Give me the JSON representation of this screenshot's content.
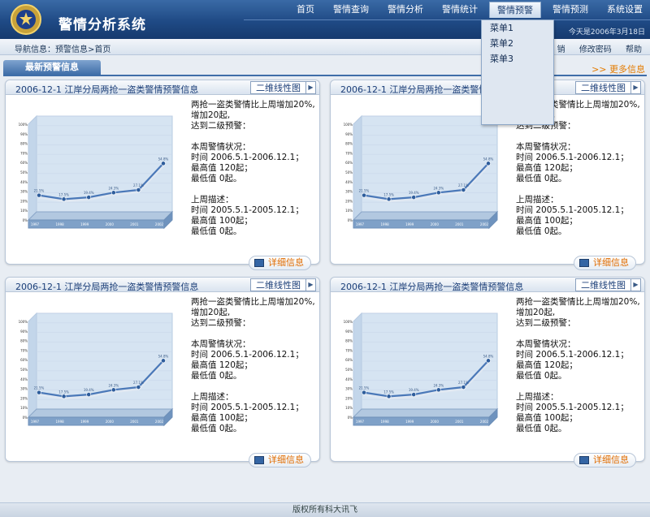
{
  "header": {
    "title": "警情分析系统",
    "user_info": "今天是2006年3月18日"
  },
  "nav": [
    "首页",
    "警情查询",
    "警情分析",
    "警情统计",
    "警情预警",
    "警情预测",
    "系统设置"
  ],
  "nav_active": 4,
  "dropdown": [
    "菜单1",
    "菜单2",
    "菜单3"
  ],
  "breadcrumb": "导航信息：预警信息>首页",
  "quick_links": [
    "销",
    "修改密码",
    "帮助"
  ],
  "section": {
    "tab": "最新预警信息",
    "more": ">> 更多信息"
  },
  "panels": [
    {
      "title": "2006-12-1 江岸分局两抢一盗类警情预警信息",
      "chart_button": "二维线性图",
      "detail": "详细信息"
    },
    {
      "title": "2006-12-1 江岸分局两抢一盗类警情预警信息",
      "chart_button": "二维线性图",
      "detail": "详细信息"
    },
    {
      "title": "2006-12-1 江岸分局两抢一盗类警情预警信息",
      "chart_button": "二维线性图",
      "detail": "详细信息"
    },
    {
      "title": "2006-12-1 江岸分局两抢一盗类警情预警信息",
      "chart_button": "二维线性图",
      "detail": "详细信息"
    }
  ],
  "desc_lines": [
    "两抢一盗类警情比上周增加20%,",
    "增加20起,",
    "达到二级预警：",
    "",
    "本周警情状况：",
    "时间    2006.5.1-2006.12.1；",
    "最高值  120起；",
    "最低值  0起。",
    "",
    "上周描述：",
    "时间    2005.5.1-2005.12.1；",
    "最高值  100起；",
    "最低值  0起。"
  ],
  "chart_data": {
    "type": "line",
    "categories": [
      "1997",
      "1998",
      "1999",
      "2000",
      "2001",
      "2002"
    ],
    "values": [
      21.5,
      17.5,
      19.4,
      24.3,
      27.1,
      54.8
    ],
    "value_labels": [
      "21.5%",
      "17.5%",
      "19.4%",
      "24.3%",
      "27.1%",
      "54.8%"
    ],
    "yticks": [
      "0%",
      "10%",
      "20%",
      "30%",
      "40%",
      "50%",
      "60%",
      "70%",
      "80%",
      "90%",
      "100%"
    ],
    "ylim": [
      0,
      100
    ],
    "colors": {
      "line": "#4a78b8",
      "wall": "#d6e4f2",
      "floor": "#7fa1c8"
    }
  },
  "footer": "版权所有科大讯飞"
}
